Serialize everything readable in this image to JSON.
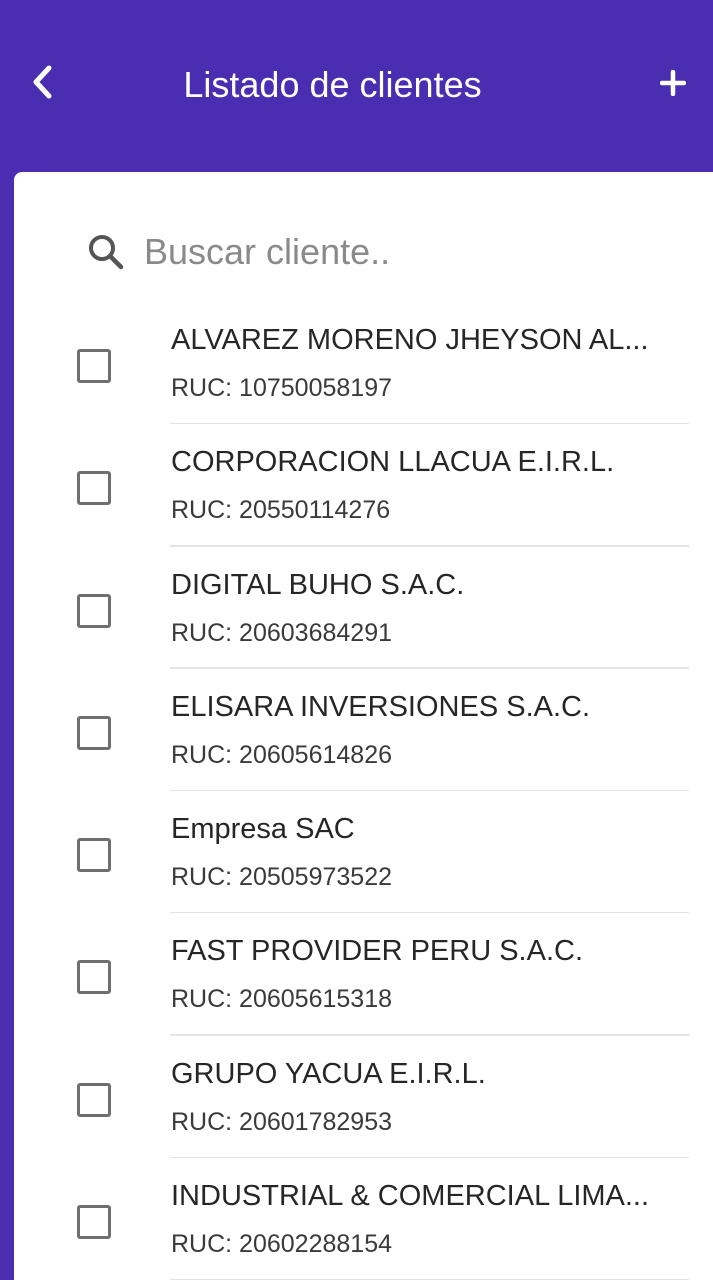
{
  "header": {
    "title": "Listado de clientes",
    "back_icon": "chevron-left-icon",
    "add_icon": "plus-icon",
    "background_color": "#4a2db0"
  },
  "search": {
    "placeholder": "Buscar cliente..",
    "value": "",
    "icon": "search-icon"
  },
  "clients": [
    {
      "name": "ALVAREZ MORENO JHEYSON AL...",
      "ruc": "RUC: 10750058197",
      "checked": false
    },
    {
      "name": "CORPORACION LLACUA E.I.R.L.",
      "ruc": "RUC: 20550114276",
      "checked": false
    },
    {
      "name": "DIGITAL BUHO S.A.C.",
      "ruc": "RUC: 20603684291",
      "checked": false
    },
    {
      "name": "ELISARA INVERSIONES S.A.C.",
      "ruc": "RUC: 20605614826",
      "checked": false
    },
    {
      "name": "Empresa SAC",
      "ruc": "RUC: 20505973522",
      "checked": false
    },
    {
      "name": "FAST PROVIDER PERU S.A.C.",
      "ruc": "RUC: 20605615318",
      "checked": false
    },
    {
      "name": "GRUPO YACUA E.I.R.L.",
      "ruc": "RUC: 20601782953",
      "checked": false
    },
    {
      "name": "INDUSTRIAL & COMERCIAL LIMA...",
      "ruc": "RUC: 20602288154",
      "checked": false
    }
  ]
}
